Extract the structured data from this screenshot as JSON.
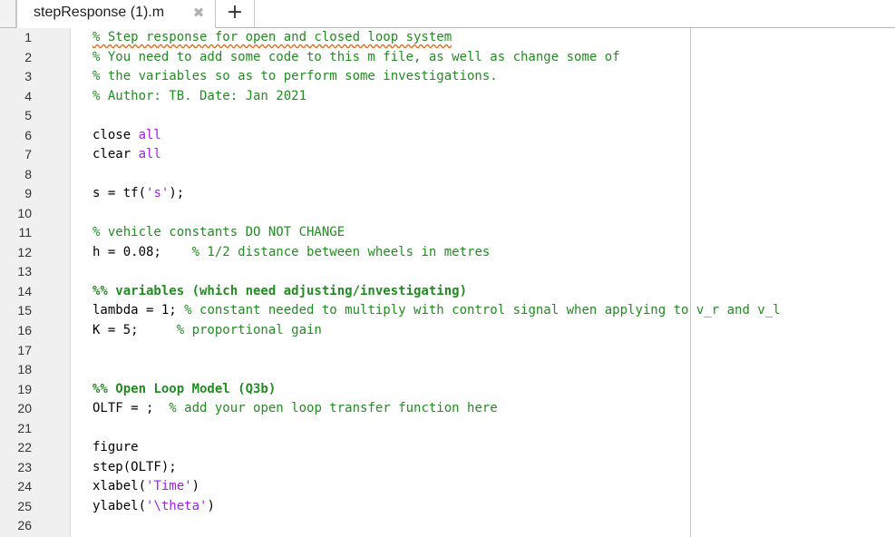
{
  "tab": {
    "title": "stepResponse (1).m",
    "close_glyph": "✖",
    "new_glyph": "+"
  },
  "code": {
    "line_numbers": [
      "1",
      "2",
      "3",
      "4",
      "5",
      "6",
      "7",
      "8",
      "9",
      "10",
      "11",
      "12",
      "13",
      "14",
      "15",
      "16",
      "17",
      "18",
      "19",
      "20",
      "21",
      "22",
      "23",
      "24",
      "25",
      "26"
    ],
    "l1": "% Step response for open and closed loop system",
    "l2": "% You need to add some code to this m file, as well as change some of",
    "l3": "% the variables so as to perform some investigations.",
    "l4": "% Author: TB. Date: Jan 2021",
    "l6a": "close ",
    "l6b": "all",
    "l7a": "clear ",
    "l7b": "all",
    "l9a": "s = tf(",
    "l9b": "'s'",
    "l9c": ");",
    "l11": "% vehicle constants DO NOT CHANGE",
    "l12a": "h = 0.08;    ",
    "l12b": "% 1/2 distance between wheels in metres",
    "l14": "%% variables (which need adjusting/investigating)",
    "l15a": "lambda = 1; ",
    "l15b": "% constant needed to multiply with control signal when applying to v_r and v_l",
    "l16a": "K = 5;     ",
    "l16b": "% proportional gain",
    "l19": "%% Open Loop Model (Q3b)",
    "l20a": "OLTF = ;  ",
    "l20b": "% add your open loop transfer function here",
    "l22": "figure",
    "l23": "step(OLTF);",
    "l24a": "xlabel(",
    "l24b": "'Time'",
    "l24c": ")",
    "l25a": "ylabel(",
    "l25b": "'\\theta'",
    "l25c": ")"
  },
  "colors": {
    "comment": "#228b22",
    "keyword": "#a020f0",
    "string": "#a020f0",
    "gutter": "#f0f0f0"
  }
}
